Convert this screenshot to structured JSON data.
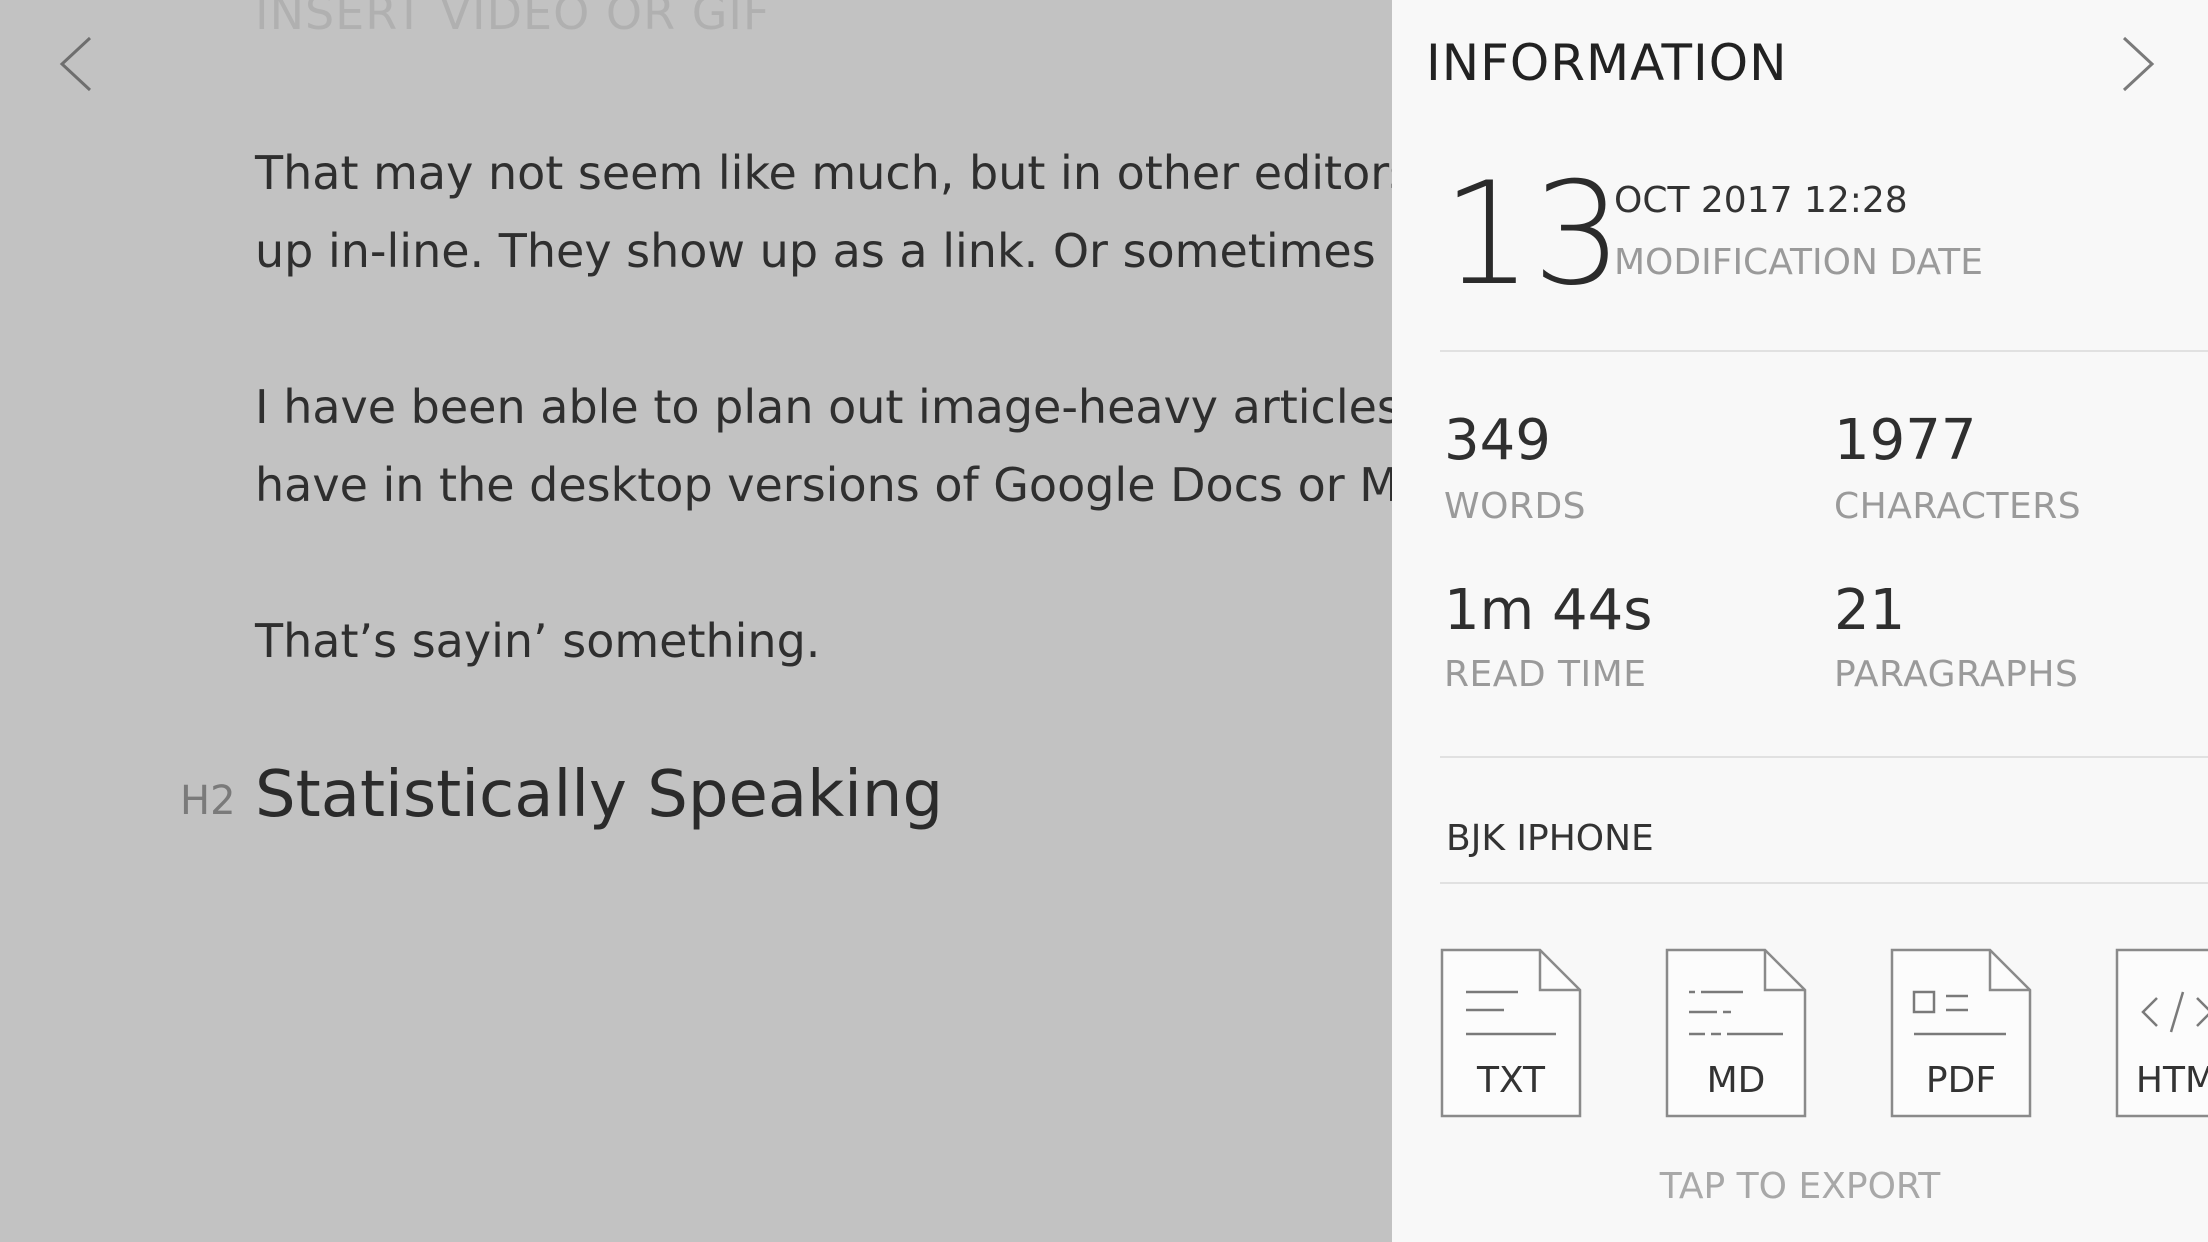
{
  "editor": {
    "faded_top": "INSERT VIDEO OR GIF",
    "paragraphs": [
      "That may not seem like much, but in other editors, th",
      "up in-line. They show up as a link. Or sometimes as a",
      "I have been able to plan out image-heavy articles in",
      "have in the desktop versions of Google Docs or MS W",
      "That’s sayin’ something."
    ],
    "heading_marker": "H2",
    "heading": "Statistically Speaking"
  },
  "info_panel": {
    "title": "INFORMATION",
    "modification": {
      "day": "13",
      "date": "OCT 2017 12:28",
      "label": "MODIFICATION DATE"
    },
    "stats": {
      "words": {
        "value": "349",
        "label": "WORDS"
      },
      "characters": {
        "value": "1977",
        "label": "CHARACTERS"
      },
      "read_time": {
        "value": "1m 44s",
        "label": "READ TIME"
      },
      "paragraphs": {
        "value": "21",
        "label": "PARAGRAPHS"
      }
    },
    "device": "BJK IPHONE",
    "export_formats": [
      {
        "label": "TXT",
        "icon": "txt-file-icon"
      },
      {
        "label": "MD",
        "icon": "md-file-icon"
      },
      {
        "label": "PDF",
        "icon": "pdf-file-icon"
      },
      {
        "label": "HTML",
        "icon": "html-file-icon"
      }
    ],
    "tap_to_export": "TAP TO EXPORT"
  }
}
